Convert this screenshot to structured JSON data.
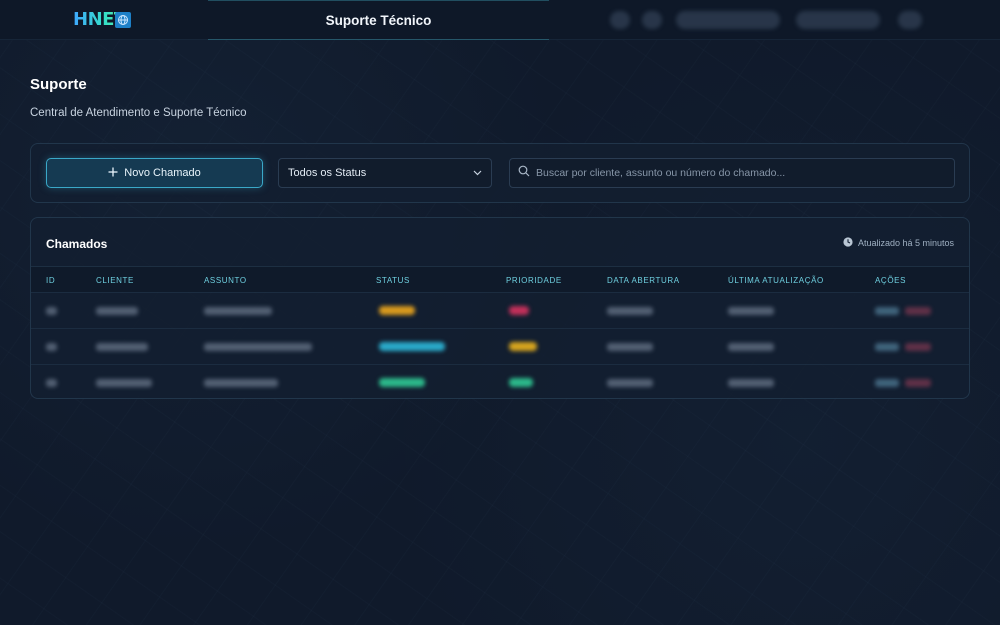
{
  "app": {
    "logo_text": "HNET",
    "title": "Suporte Técnico"
  },
  "page": {
    "title": "Suporte",
    "subtitle": "Central de Atendimento e Suporte Técnico"
  },
  "toolbar": {
    "new_ticket_label": "Novo Chamado",
    "status_filter_value": "Todos os Status",
    "search_placeholder": "Buscar por cliente, assunto ou número do chamado..."
  },
  "table": {
    "title": "Chamados",
    "updated_text": "Atualizado há 5 minutos",
    "columns": [
      "ID",
      "CLIENTE",
      "ASSUNTO",
      "STATUS",
      "PRIORIDADE",
      "DATA ABERTURA",
      "ÚLTIMA ATUALIZAÇÃO",
      "AÇÕES"
    ]
  },
  "colors": {
    "accent": "#3aa8c8",
    "header_text": "#6fd0e0",
    "status_pending": "#d99a1e",
    "status_progress": "#2aa9c9",
    "status_resolved": "#2cb88a",
    "priority_high": "#c2305a",
    "priority_medium": "#d6a41e",
    "priority_low": "#2cb88a"
  }
}
